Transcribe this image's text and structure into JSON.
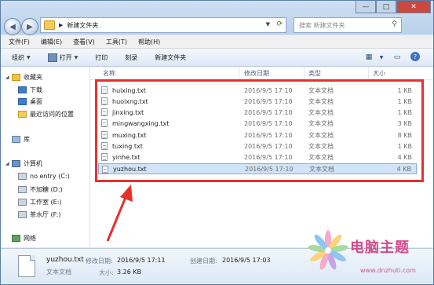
{
  "address": {
    "path": "新建文件夹"
  },
  "search": {
    "placeholder": "搜索 新建文件夹"
  },
  "menubar": [
    {
      "label": "文件(F)"
    },
    {
      "label": "编辑(E)"
    },
    {
      "label": "查看(V)"
    },
    {
      "label": "工具(T)"
    },
    {
      "label": "帮助(H)"
    }
  ],
  "toolbar": {
    "organize": "组织",
    "open": "打开",
    "print": "打印",
    "burn": "刻录",
    "new_folder": "新建文件夹"
  },
  "nav": {
    "favorites": "收藏夹",
    "downloads": "下载",
    "desktop": "桌面",
    "recent": "最近访问的位置",
    "libraries": "库",
    "computer": "计算机",
    "drive_c": "no entry (C:)",
    "drive_d": "不加糖 (D:)",
    "drive_e": "工作室 (E:)",
    "drive_f": "茶水厅 (F:)",
    "network": "网络"
  },
  "columns": {
    "name": "名称",
    "date": "修改日期",
    "type": "类型",
    "size": "大小"
  },
  "files": [
    {
      "name": "huixing.txt",
      "date": "2016/9/5 17:10",
      "type": "文本文档",
      "size": "1 KB"
    },
    {
      "name": "huoixng.txt",
      "date": "2016/9/5 17:10",
      "type": "文本文档",
      "size": "1 KB"
    },
    {
      "name": "jinxing.txt",
      "date": "2016/9/5 17:10",
      "type": "文本文档",
      "size": "1 KB"
    },
    {
      "name": "mingwangxing.txt",
      "date": "2016/9/5 17:10",
      "type": "文本文档",
      "size": "3 KB"
    },
    {
      "name": "muxing.txt",
      "date": "2016/9/5 17:10",
      "type": "文本文档",
      "size": "8 KB"
    },
    {
      "name": "tuxing.txt",
      "date": "2016/9/5 17:10",
      "type": "文本文档",
      "size": "1 KB"
    },
    {
      "name": "yinhe.txt",
      "date": "2016/9/5 17:10",
      "type": "文本文档",
      "size": "4 KB"
    },
    {
      "name": "yuzhou.txt",
      "date": "2016/9/5 17:10",
      "type": "文本文档",
      "size": "4 KB",
      "selected": true
    }
  ],
  "details": {
    "filename": "yuzhou.txt",
    "filetype": "文本文档",
    "modified_label": "修改日期:",
    "modified": "2016/9/5 17:11",
    "created_label": "创建日期:",
    "created": "2016/9/5 17:03",
    "size_label": "大小:",
    "size": "3.26 KB"
  },
  "watermark": {
    "brand": "电脑主题",
    "url": "www.dnzhuti.com"
  }
}
